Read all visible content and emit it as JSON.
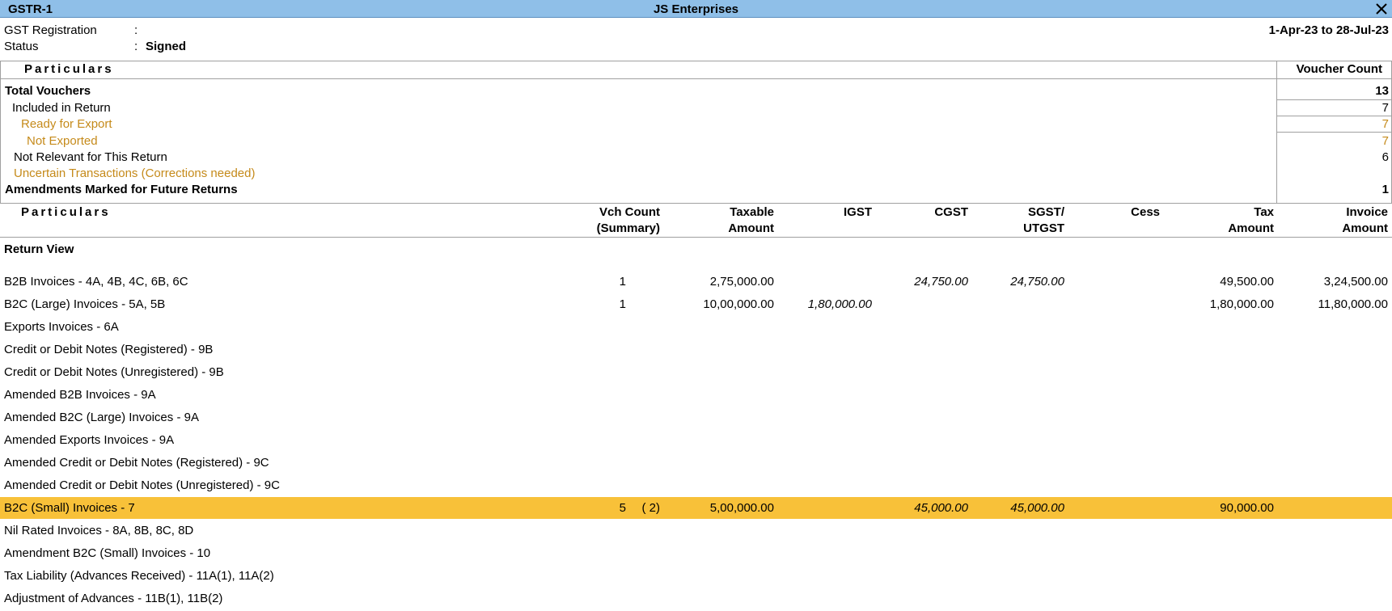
{
  "window": {
    "left_title": "GSTR-1",
    "company": "JS Enterprises",
    "close_glyph": "✕"
  },
  "header": {
    "gst_registration_label": "GST Registration",
    "gst_registration_value": "",
    "status_label": "Status",
    "status_value": "Signed",
    "colon": ":",
    "period": "1-Apr-23 to 28-Jul-23"
  },
  "summary": {
    "particulars_header": "Particulars",
    "voucher_count_header": "Voucher Count",
    "rows": [
      {
        "label": "Total Vouchers",
        "value": "13"
      },
      {
        "label": "Included in Return",
        "value": "7"
      },
      {
        "label": "Ready for Export",
        "value": "7"
      },
      {
        "label": "Not Exported",
        "value": "7"
      },
      {
        "label": "Not Relevant for This Return",
        "value": "6"
      },
      {
        "label": "Uncertain Transactions (Corrections needed)",
        "value": ""
      },
      {
        "label": "Amendments Marked for Future Returns",
        "value": "1"
      }
    ]
  },
  "table": {
    "headers": {
      "particulars": "Particulars",
      "vch_count_1": "Vch Count",
      "vch_count_2": "(Summary)",
      "taxable_1": "Taxable",
      "taxable_2": "Amount",
      "igst": "IGST",
      "cgst": "CGST",
      "sgst_1": "SGST/",
      "sgst_2": "UTGST",
      "cess": "Cess",
      "tax_1": "Tax",
      "tax_2": "Amount",
      "invoice_1": "Invoice",
      "invoice_2": "Amount"
    },
    "return_view_label": "Return View",
    "rows": [
      {
        "label": "B2B Invoices - 4A, 4B, 4C, 6B, 6C",
        "vch": "1",
        "summary": "",
        "taxable": "2,75,000.00",
        "igst": "",
        "cgst": "24,750.00",
        "sgst": "24,750.00",
        "cess": "",
        "tax": "49,500.00",
        "invoice": "3,24,500.00"
      },
      {
        "label": "B2C (Large) Invoices - 5A, 5B",
        "vch": "1",
        "summary": "",
        "taxable": "10,00,000.00",
        "igst": "1,80,000.00",
        "cgst": "",
        "sgst": "",
        "cess": "",
        "tax": "1,80,000.00",
        "invoice": "11,80,000.00"
      },
      {
        "label": "Exports Invoices - 6A",
        "vch": "",
        "summary": "",
        "taxable": "",
        "igst": "",
        "cgst": "",
        "sgst": "",
        "cess": "",
        "tax": "",
        "invoice": ""
      },
      {
        "label": "Credit or Debit Notes (Registered) - 9B",
        "vch": "",
        "summary": "",
        "taxable": "",
        "igst": "",
        "cgst": "",
        "sgst": "",
        "cess": "",
        "tax": "",
        "invoice": ""
      },
      {
        "label": "Credit or Debit Notes (Unregistered) - 9B",
        "vch": "",
        "summary": "",
        "taxable": "",
        "igst": "",
        "cgst": "",
        "sgst": "",
        "cess": "",
        "tax": "",
        "invoice": ""
      },
      {
        "label": "Amended B2B Invoices - 9A",
        "vch": "",
        "summary": "",
        "taxable": "",
        "igst": "",
        "cgst": "",
        "sgst": "",
        "cess": "",
        "tax": "",
        "invoice": ""
      },
      {
        "label": "Amended B2C (Large) Invoices - 9A",
        "vch": "",
        "summary": "",
        "taxable": "",
        "igst": "",
        "cgst": "",
        "sgst": "",
        "cess": "",
        "tax": "",
        "invoice": ""
      },
      {
        "label": "Amended Exports Invoices - 9A",
        "vch": "",
        "summary": "",
        "taxable": "",
        "igst": "",
        "cgst": "",
        "sgst": "",
        "cess": "",
        "tax": "",
        "invoice": ""
      },
      {
        "label": "Amended Credit or Debit Notes (Registered) - 9C",
        "vch": "",
        "summary": "",
        "taxable": "",
        "igst": "",
        "cgst": "",
        "sgst": "",
        "cess": "",
        "tax": "",
        "invoice": ""
      },
      {
        "label": "Amended Credit or Debit Notes (Unregistered) - 9C",
        "vch": "",
        "summary": "",
        "taxable": "",
        "igst": "",
        "cgst": "",
        "sgst": "",
        "cess": "",
        "tax": "",
        "invoice": ""
      },
      {
        "label": "B2C (Small) Invoices - 7",
        "vch": "5",
        "summary": "( 2)",
        "taxable": "5,00,000.00",
        "igst": "",
        "cgst": "45,000.00",
        "sgst": "45,000.00",
        "cess": "",
        "tax": "90,000.00",
        "invoice": ""
      },
      {
        "label": "Nil Rated Invoices - 8A, 8B, 8C, 8D",
        "vch": "",
        "summary": "",
        "taxable": "",
        "igst": "",
        "cgst": "",
        "sgst": "",
        "cess": "",
        "tax": "",
        "invoice": ""
      },
      {
        "label": "Amendment B2C (Small) Invoices - 10",
        "vch": "",
        "summary": "",
        "taxable": "",
        "igst": "",
        "cgst": "",
        "sgst": "",
        "cess": "",
        "tax": "",
        "invoice": ""
      },
      {
        "label": "Tax Liability (Advances Received) - 11A(1), 11A(2)",
        "vch": "",
        "summary": "",
        "taxable": "",
        "igst": "",
        "cgst": "",
        "sgst": "",
        "cess": "",
        "tax": "",
        "invoice": ""
      },
      {
        "label": "Adjustment of Advances - 11B(1), 11B(2)",
        "vch": "",
        "summary": "",
        "taxable": "",
        "igst": "",
        "cgst": "",
        "sgst": "",
        "cess": "",
        "tax": "",
        "invoice": ""
      }
    ]
  },
  "colors": {
    "title_bar": "#8fbfe8",
    "highlight": "#f8c139",
    "accent_text": "#c58a1a"
  }
}
